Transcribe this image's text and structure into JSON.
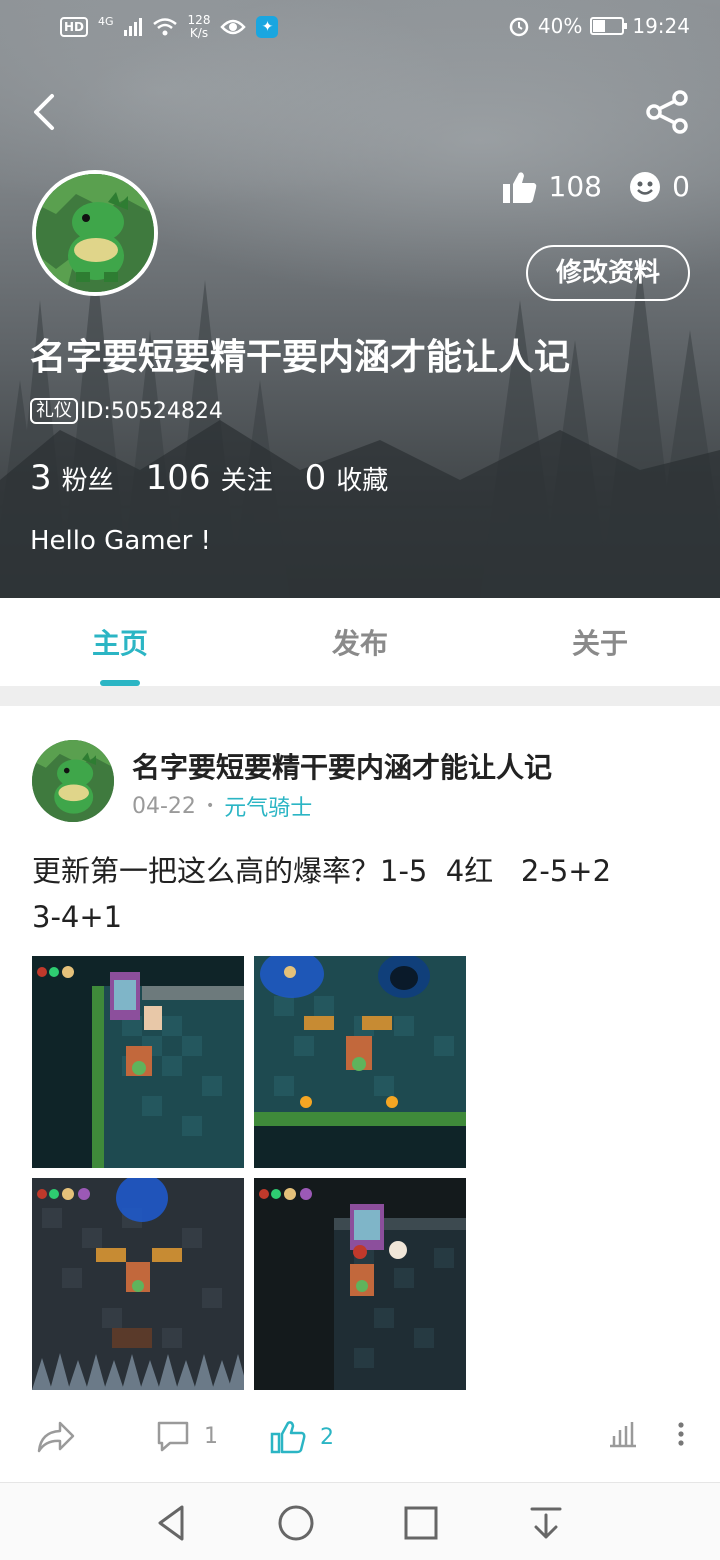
{
  "status_bar": {
    "hd": "HD",
    "network": "4G",
    "speed": "128\nK/s",
    "battery": "40%",
    "battery_level": 0.4,
    "time": "19:24"
  },
  "header": {
    "likes": "108",
    "smiles": "0",
    "edit_label": "修改资料",
    "username": "名字要短要精干要内涵才能让人记",
    "badge": "礼仪",
    "id_text": "ID:50524824",
    "stats": [
      {
        "num": "3",
        "label": "粉丝"
      },
      {
        "num": "106",
        "label": "关注"
      },
      {
        "num": "0",
        "label": "收藏"
      }
    ],
    "bio": "Hello Gamer !"
  },
  "tabs": [
    {
      "label": "主页",
      "active": true
    },
    {
      "label": "发布",
      "active": false
    },
    {
      "label": "关于",
      "active": false
    }
  ],
  "post": {
    "author": "名字要短要精干要内涵才能让人记",
    "date": "04-22",
    "dot": "•",
    "game": "元气骑士",
    "text": "更新第一把这么高的爆率？1-5  4红   2-5+2\n3-4+1",
    "images": [
      "game-screenshot-1",
      "game-screenshot-2",
      "game-screenshot-3",
      "game-screenshot-4"
    ],
    "comments": "1",
    "likes": "2"
  },
  "colors": {
    "accent": "#2bb5c4",
    "muted": "#9a9a9a"
  }
}
